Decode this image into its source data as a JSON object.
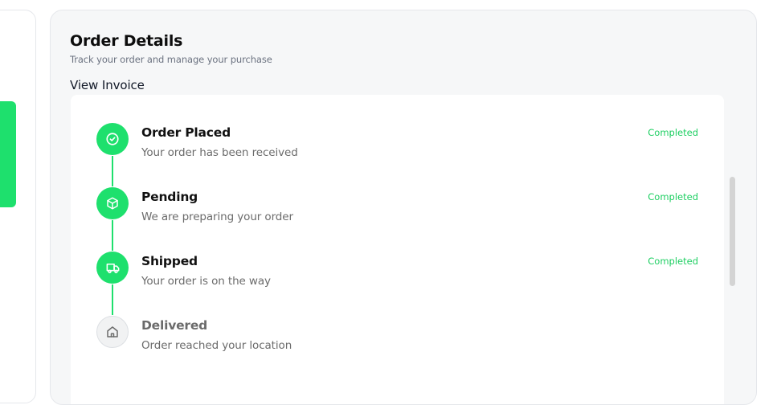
{
  "header": {
    "title": "Order Details",
    "subtitle": "Track your order and manage your purchase",
    "invoice_link": "View Invoice"
  },
  "steps": [
    {
      "title": "Order Placed",
      "description": "Your order has been received",
      "status": "Completed",
      "icon": "check-circle-icon"
    },
    {
      "title": "Pending",
      "description": "We are preparing your order",
      "status": "Completed",
      "icon": "package-icon"
    },
    {
      "title": "Shipped",
      "description": "Your order is on the way",
      "status": "Completed",
      "icon": "truck-icon"
    },
    {
      "title": "Delivered",
      "description": "Order reached your location",
      "status": "",
      "icon": "home-icon"
    }
  ],
  "colors": {
    "accent": "#1ee06d",
    "status_text": "#1ecf62",
    "panel_bg": "#f6f7f8"
  }
}
